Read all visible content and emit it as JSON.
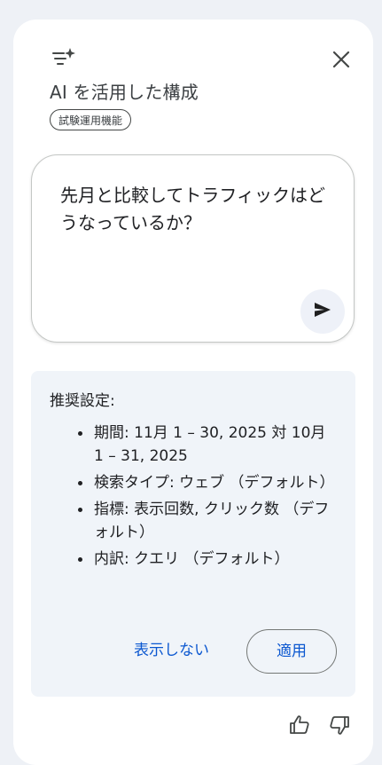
{
  "header": {
    "title": "AI を活用した構成",
    "badge": "試験運用機能",
    "icon": "sparkle-filter-icon",
    "close_icon": "close-icon"
  },
  "prompt": {
    "text": "先月と比較してトラフィックはどうなっているか？",
    "send_icon": "send-icon"
  },
  "suggestion": {
    "heading": "推奨設定:",
    "items": [
      "期間: 11月 1 – 30, 2025 対 10月 1 – 31, 2025",
      "検索タイプ: ウェブ （デフォルト）",
      "指標: 表示回数, クリック数 （デフォルト）",
      "内訳: クエリ （デフォルト）"
    ],
    "dismiss_label": "表示しない",
    "apply_label": "適用"
  },
  "feedback": {
    "thumbs_up_icon": "thumbs-up-icon",
    "thumbs_down_icon": "thumbs-down-icon"
  },
  "colors": {
    "background": "#eef1f6",
    "panel": "#ffffff",
    "suggestion_bg": "#f0f4f9",
    "accent": "#0b57d0",
    "text": "#202124"
  }
}
